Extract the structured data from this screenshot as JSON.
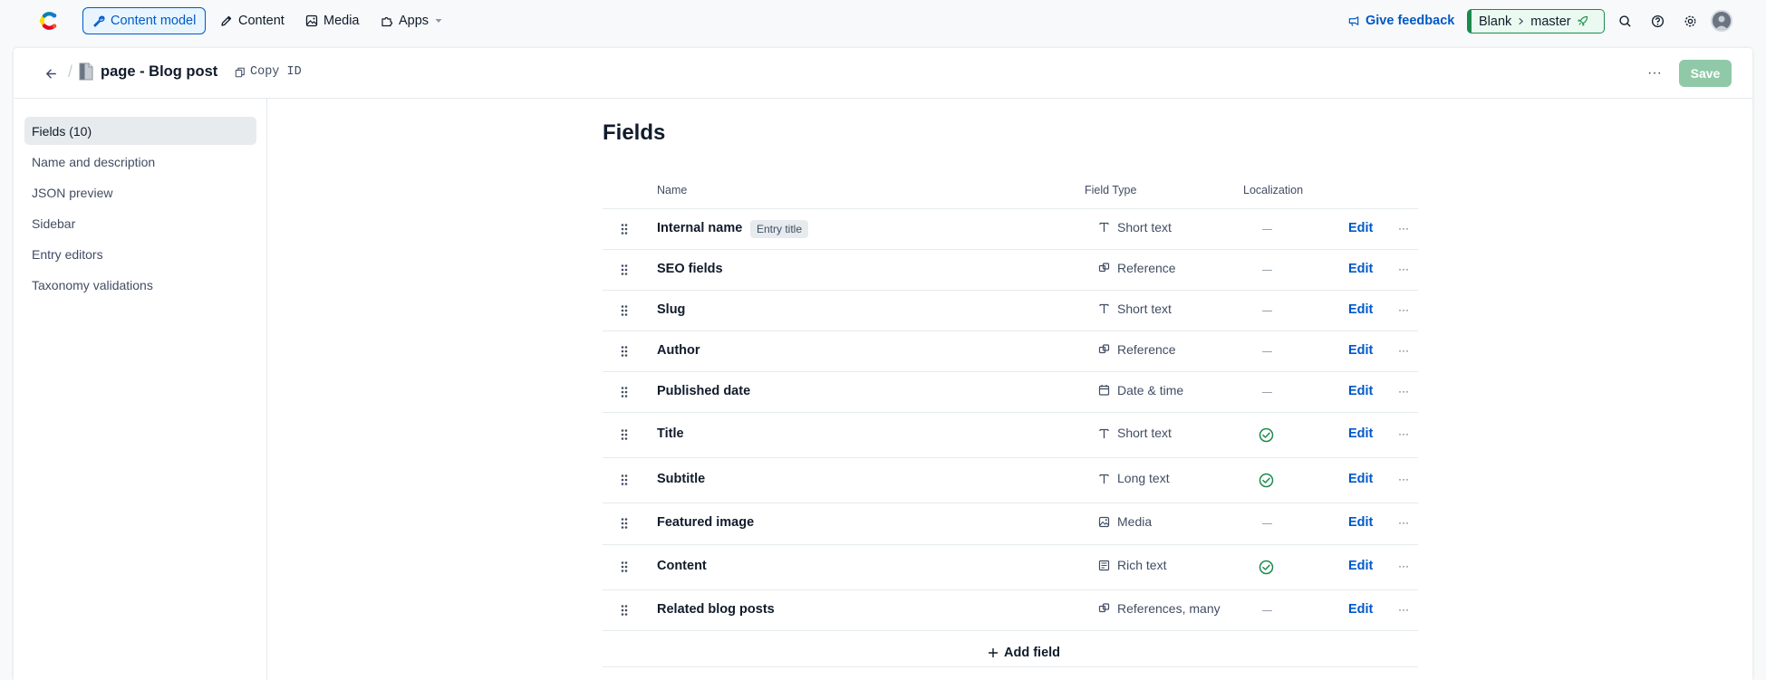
{
  "nav": {
    "items": [
      {
        "label": "Content model",
        "icon": "wrench-icon",
        "active": true
      },
      {
        "label": "Content",
        "icon": "pen-icon",
        "active": false
      },
      {
        "label": "Media",
        "icon": "image-icon",
        "active": false
      },
      {
        "label": "Apps",
        "icon": "puzzle-icon",
        "active": false
      }
    ],
    "feedback_label": "Give feedback",
    "environment": {
      "space": "Blank",
      "env": "master"
    }
  },
  "header": {
    "title": "page - Blog post",
    "copy_id_label": "Copy ID",
    "save_label": "Save"
  },
  "sidebar": {
    "items": [
      {
        "label": "Fields (10)",
        "active": true
      },
      {
        "label": "Name and description"
      },
      {
        "label": "JSON preview"
      },
      {
        "label": "Sidebar"
      },
      {
        "label": "Entry editors"
      },
      {
        "label": "Taxonomy validations"
      }
    ]
  },
  "fields": {
    "title": "Fields",
    "columns": {
      "name": "Name",
      "type": "Field Type",
      "localization": "Localization"
    },
    "edit_label": "Edit",
    "add_label": "Add field",
    "rows": [
      {
        "name": "Internal name",
        "badge": "Entry title",
        "type": "Short text",
        "icon": "text-icon",
        "localized": false
      },
      {
        "name": "SEO fields",
        "type": "Reference",
        "icon": "reference-icon",
        "localized": false
      },
      {
        "name": "Slug",
        "type": "Short text",
        "icon": "text-icon",
        "localized": false
      },
      {
        "name": "Author",
        "type": "Reference",
        "icon": "reference-icon",
        "localized": false
      },
      {
        "name": "Published date",
        "type": "Date & time",
        "icon": "calendar-icon",
        "localized": false
      },
      {
        "name": "Title",
        "type": "Short text",
        "icon": "text-icon",
        "localized": true
      },
      {
        "name": "Subtitle",
        "type": "Long text",
        "icon": "text-icon",
        "localized": true
      },
      {
        "name": "Featured image",
        "type": "Media",
        "icon": "image-icon",
        "localized": false
      },
      {
        "name": "Content",
        "type": "Rich text",
        "icon": "richtext-icon",
        "localized": true
      },
      {
        "name": "Related blog posts",
        "type": "References, many",
        "icon": "reference-icon",
        "localized": false
      }
    ]
  },
  "colors": {
    "accent": "#0059c8",
    "positive": "#1c8a4e",
    "save_disabled": "#8fc9a8"
  }
}
